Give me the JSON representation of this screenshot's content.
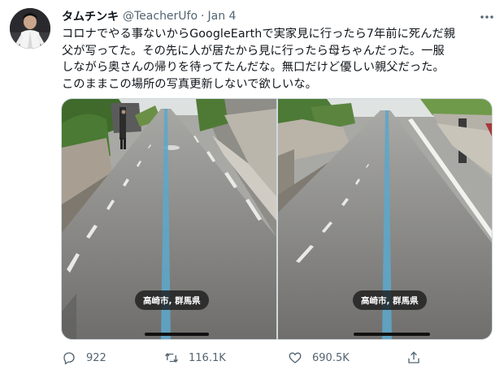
{
  "tweet": {
    "display_name": "タムチンキ",
    "handle": "@TeacherUfo",
    "separator": "·",
    "date": "Jan 4",
    "text_lines": [
      "コロナでやる事ないからGoogleEarthで実家見に行ったら7年前に死んだ親",
      "父が写ってた。その先に人が居たから見に行ったら母ちゃんだった。一服",
      "しながら奥さんの帰りを待ってたんだな。無口だけど優しい親父だった。",
      "このままこの場所の写真更新しないで欲しいな。"
    ],
    "media": [
      {
        "location_label": "高崎市, 群馬県"
      },
      {
        "location_label": "高崎市, 群馬県"
      }
    ],
    "actions": {
      "reply_count": "922",
      "retweet_count": "116.1K",
      "like_count": "690.5K"
    },
    "icons": [
      "avatar",
      "more-icon",
      "reply-icon",
      "retweet-icon",
      "like-icon",
      "share-icon"
    ]
  }
}
